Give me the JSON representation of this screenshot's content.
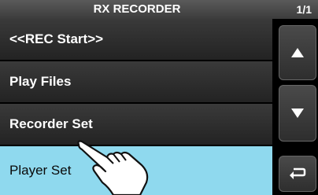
{
  "window": {
    "title": "RX RECORDER",
    "page_indicator": "1/1"
  },
  "menu": {
    "items": [
      {
        "label": "<<REC Start>>"
      },
      {
        "label": "Play Files"
      },
      {
        "label": "Recorder Set"
      },
      {
        "label": "Player Set",
        "selected": true
      }
    ]
  },
  "icons": {
    "scroll_up": "triangle-up-icon",
    "scroll_down": "triangle-down-icon",
    "back": "return-arrow-icon",
    "pointer": "pointing-hand-icon"
  },
  "colors": {
    "selected_bg": "#8fd9ee",
    "item_bg": "#2b2b2b",
    "title_bg": "#4a4a4a"
  }
}
